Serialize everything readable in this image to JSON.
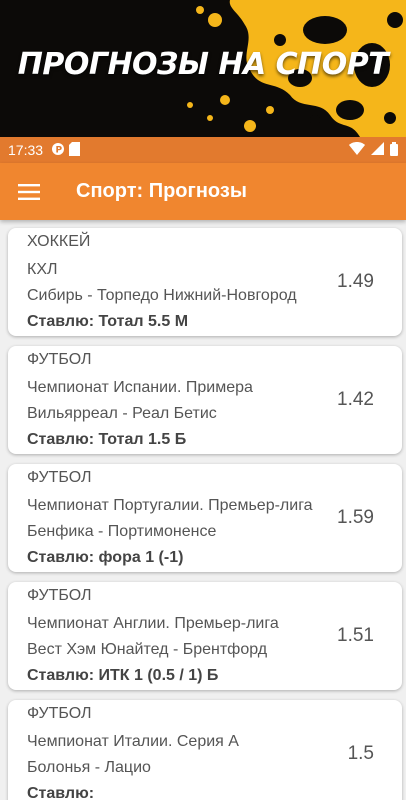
{
  "banner": {
    "title": "ПРОГНОЗЫ НА СПОРТ"
  },
  "status_bar": {
    "time": "17:33"
  },
  "app_bar": {
    "title": "Спорт: Прогнозы",
    "menu_icon": "hamburger-menu-icon"
  },
  "colors": {
    "accent": "#f0862f",
    "status": "#e27a2e",
    "banner_bg": "#0c0a08",
    "splash": "#f5b61a"
  },
  "predictions": [
    {
      "sport": "ХОККЕЙ",
      "league": "КХЛ",
      "match": "Сибирь - Торпедо Нижний-Новгород",
      "bet": "Ставлю: Тотал 5.5 М",
      "odds": "1.49"
    },
    {
      "sport": "ФУТБОЛ",
      "league": "Чемпионат Испании. Примера",
      "match": "Вильярреал - Реал Бетис",
      "bet": "Ставлю: Тотал 1.5 Б",
      "odds": "1.42"
    },
    {
      "sport": "ФУТБОЛ",
      "league": "Чемпионат Португалии. Премьер-лига",
      "match": "Бенфика - Портимоненсе",
      "bet": "Ставлю: фора 1 (-1)",
      "odds": "1.59"
    },
    {
      "sport": "ФУТБОЛ",
      "league": "Чемпионат Англии. Премьер-лига",
      "match": "Вест Хэм Юнайтед - Брентфорд",
      "bet": "Ставлю: ИТК 1 (0.5 / 1) Б",
      "odds": "1.51"
    },
    {
      "sport": "ФУТБОЛ",
      "league": "Чемпионат Италии. Серия А",
      "match": "Болонья - Лацио",
      "bet": "Ставлю: ",
      "odds": "1.5"
    }
  ]
}
